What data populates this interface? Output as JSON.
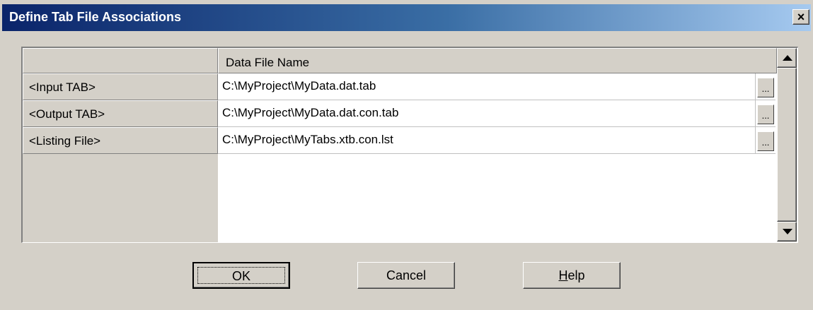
{
  "window": {
    "title": "Define Tab File Associations",
    "close_label": "×"
  },
  "grid": {
    "column_header": "Data File Name",
    "rows": [
      {
        "label": "<Input TAB>",
        "value": "C:\\MyProject\\MyData.dat.tab",
        "browse": "..."
      },
      {
        "label": "<Output TAB>",
        "value": "C:\\MyProject\\MyData.dat.con.tab",
        "browse": "..."
      },
      {
        "label": "<Listing File>",
        "value": "C:\\MyProject\\MyTabs.xtb.con.lst",
        "browse": "..."
      }
    ]
  },
  "buttons": {
    "ok": "OK",
    "cancel": "Cancel",
    "help_first": "H",
    "help_rest": "elp"
  },
  "colors": {
    "title_gradient_start": "#0a246a",
    "title_gradient_end": "#a6caf0",
    "face": "#d4d0c8"
  }
}
